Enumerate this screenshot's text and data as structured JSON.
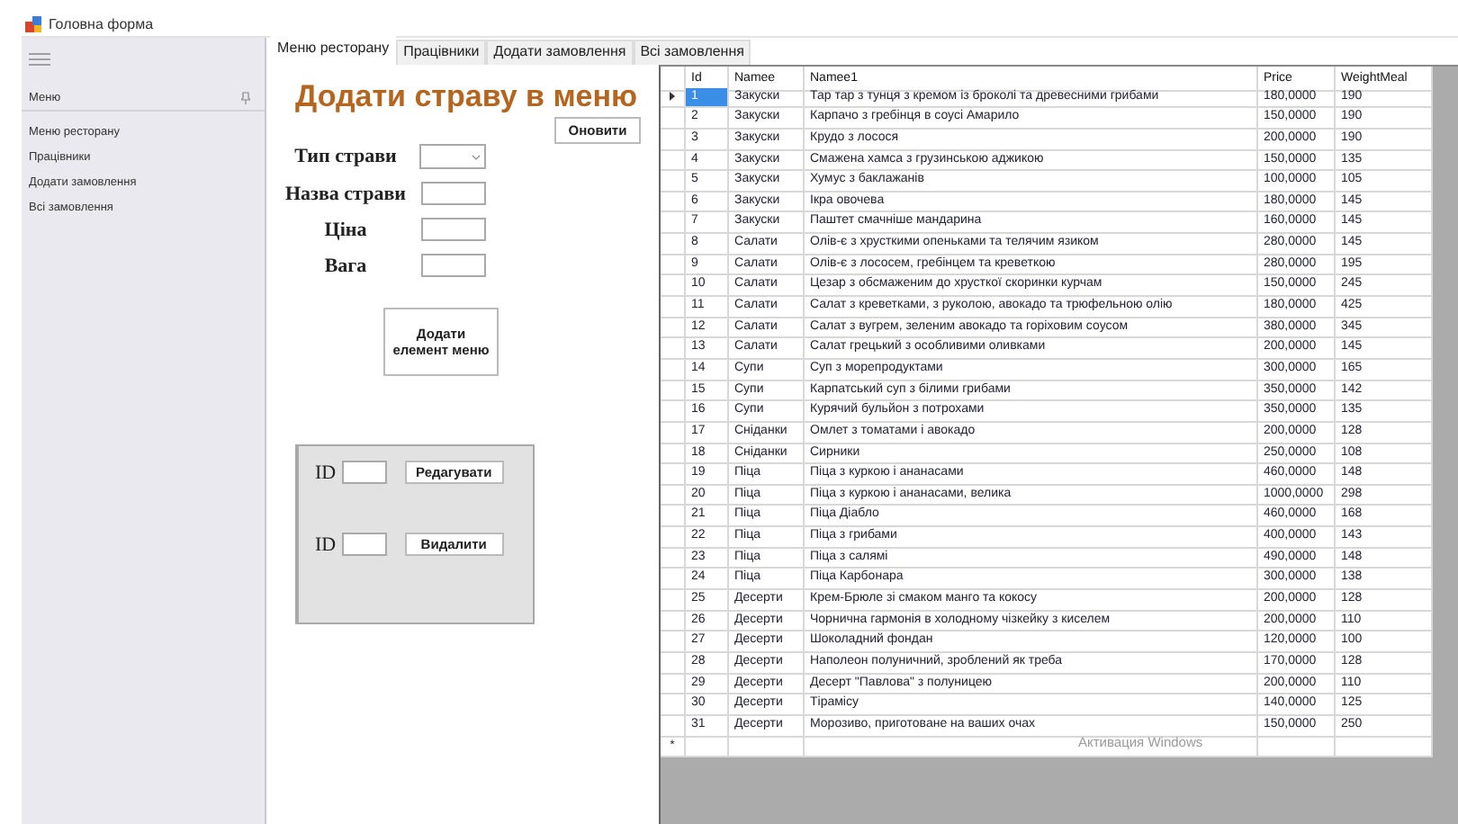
{
  "window": {
    "title": "Головна форма"
  },
  "sidebar": {
    "header": "Меню",
    "items": [
      {
        "label": "Меню ресторану"
      },
      {
        "label": "Працівники"
      },
      {
        "label": "Додати замовлення"
      },
      {
        "label": "Всі замовлення"
      }
    ]
  },
  "tabs": [
    {
      "label": "Меню ресторану",
      "selected": true
    },
    {
      "label": "Працівники",
      "selected": false
    },
    {
      "label": "Додати замовлення",
      "selected": false
    },
    {
      "label": "Всі замовлення",
      "selected": false
    }
  ],
  "form": {
    "title": "Додати страву в меню",
    "refresh_button": "Оновити",
    "fields": [
      {
        "label": "Тип страви",
        "kind": "dropdown"
      },
      {
        "label": "Назва страви",
        "kind": "text"
      },
      {
        "label": "Ціна",
        "kind": "text"
      },
      {
        "label": "Вага",
        "kind": "text"
      }
    ],
    "add_button": "Додати елемент меню"
  },
  "edit_panel": {
    "rows": [
      {
        "label": "ID",
        "button": "Редагувати"
      },
      {
        "label": "ID",
        "button": "Видалити"
      }
    ]
  },
  "table": {
    "columns": [
      "Id",
      "Namee",
      "Namee1",
      "Price",
      "WeightMeal"
    ],
    "rows": [
      {
        "cells": [
          "1",
          "Закуски",
          "Тар тар з тунця з кремом із броколі та древесними грибами",
          "180,0000",
          "190"
        ],
        "selected": true
      },
      {
        "cells": [
          "2",
          "Закуски",
          "Карпачо з гребінця в соусі Амарило",
          "150,0000",
          "190"
        ],
        "selected": false
      },
      {
        "cells": [
          "3",
          "Закуски",
          "Крудо з лосося",
          "200,0000",
          "190"
        ],
        "selected": false
      },
      {
        "cells": [
          "4",
          "Закуски",
          "Смажена хамса з грузинською аджикою",
          "150,0000",
          "135"
        ],
        "selected": false
      },
      {
        "cells": [
          "5",
          "Закуски",
          "Хумус з баклажанів",
          "100,0000",
          "105"
        ],
        "selected": false
      },
      {
        "cells": [
          "6",
          "Закуски",
          "Ікра овочева",
          "180,0000",
          "145"
        ],
        "selected": false
      },
      {
        "cells": [
          "7",
          "Закуски",
          "Паштет смачніше мандарина",
          "160,0000",
          "145"
        ],
        "selected": false
      },
      {
        "cells": [
          "8",
          "Салати",
          "Олів-є з хрусткими опеньками та телячим язиком",
          "280,0000",
          "145"
        ],
        "selected": false
      },
      {
        "cells": [
          "9",
          "Салати",
          "Олів-є з лососем, гребінцем та креветкою",
          "280,0000",
          "195"
        ],
        "selected": false
      },
      {
        "cells": [
          "10",
          "Салати",
          "Цезар з обсмаженим до хрусткої скоринки курчам",
          "150,0000",
          "245"
        ],
        "selected": false
      },
      {
        "cells": [
          "11",
          "Салати",
          "Салат з креветками, з руколою, авокадо та трюфельною олію",
          "180,0000",
          "425"
        ],
        "selected": false
      },
      {
        "cells": [
          "12",
          "Салати",
          "Салат з вугрем, зеленим авокадо та горіховим соусом",
          "380,0000",
          "345"
        ],
        "selected": false
      },
      {
        "cells": [
          "13",
          "Салати",
          "Салат грецький з особливими оливками",
          "200,0000",
          "145"
        ],
        "selected": false
      },
      {
        "cells": [
          "14",
          "Супи",
          "Суп з морепродуктами",
          "300,0000",
          "165"
        ],
        "selected": false
      },
      {
        "cells": [
          "15",
          "Супи",
          "Карпатський суп з білими грибами",
          "350,0000",
          "142"
        ],
        "selected": false
      },
      {
        "cells": [
          "16",
          "Супи",
          "Курячий бульйон з потрохами",
          "350,0000",
          "135"
        ],
        "selected": false
      },
      {
        "cells": [
          "17",
          "Сніданки",
          "Омлет з томатами і авокадо",
          "200,0000",
          "128"
        ],
        "selected": false
      },
      {
        "cells": [
          "18",
          "Сніданки",
          "Сирники",
          "250,0000",
          "108"
        ],
        "selected": false
      },
      {
        "cells": [
          "19",
          "Піца",
          "Піца з куркою і ананасами",
          "460,0000",
          "148"
        ],
        "selected": false
      },
      {
        "cells": [
          "20",
          "Піца",
          "Піца з куркою і ананасами, велика",
          "1000,0000",
          "298"
        ],
        "selected": false
      },
      {
        "cells": [
          "21",
          "Піца",
          "Піца Діабло",
          "460,0000",
          "168"
        ],
        "selected": false
      },
      {
        "cells": [
          "22",
          "Піца",
          "Піца з грибами",
          "400,0000",
          "143"
        ],
        "selected": false
      },
      {
        "cells": [
          "23",
          "Піца",
          "Піца з салямі",
          "490,0000",
          "148"
        ],
        "selected": false
      },
      {
        "cells": [
          "24",
          "Піца",
          "Піца Карбонара",
          "300,0000",
          "138"
        ],
        "selected": false
      },
      {
        "cells": [
          "25",
          "Десерти",
          "Крем-Брюле зі смаком манго та кокосу",
          "200,0000",
          "128"
        ],
        "selected": false
      },
      {
        "cells": [
          "26",
          "Десерти",
          "Чорнична гармонія в холодному чізкейку з киселем",
          "200,0000",
          "110"
        ],
        "selected": false
      },
      {
        "cells": [
          "27",
          "Десерти",
          "Шоколадний фондан",
          "120,0000",
          "100"
        ],
        "selected": false
      },
      {
        "cells": [
          "28",
          "Десерти",
          "Наполеон полуничний, зроблений як треба",
          "170,0000",
          "128"
        ],
        "selected": false
      },
      {
        "cells": [
          "29",
          "Десерти",
          "Десерт \"Павлова\" з полуницею",
          "200,0000",
          "110"
        ],
        "selected": false
      },
      {
        "cells": [
          "30",
          "Десерти",
          "Тірамісу",
          "140,0000",
          "125"
        ],
        "selected": false
      },
      {
        "cells": [
          "31",
          "Десерти",
          "Морозиво, приготоване на ваших очах",
          "150,0000",
          "250"
        ],
        "selected": false
      }
    ],
    "new_row_marker": "*"
  },
  "activation_notice": "Активация Windows"
}
